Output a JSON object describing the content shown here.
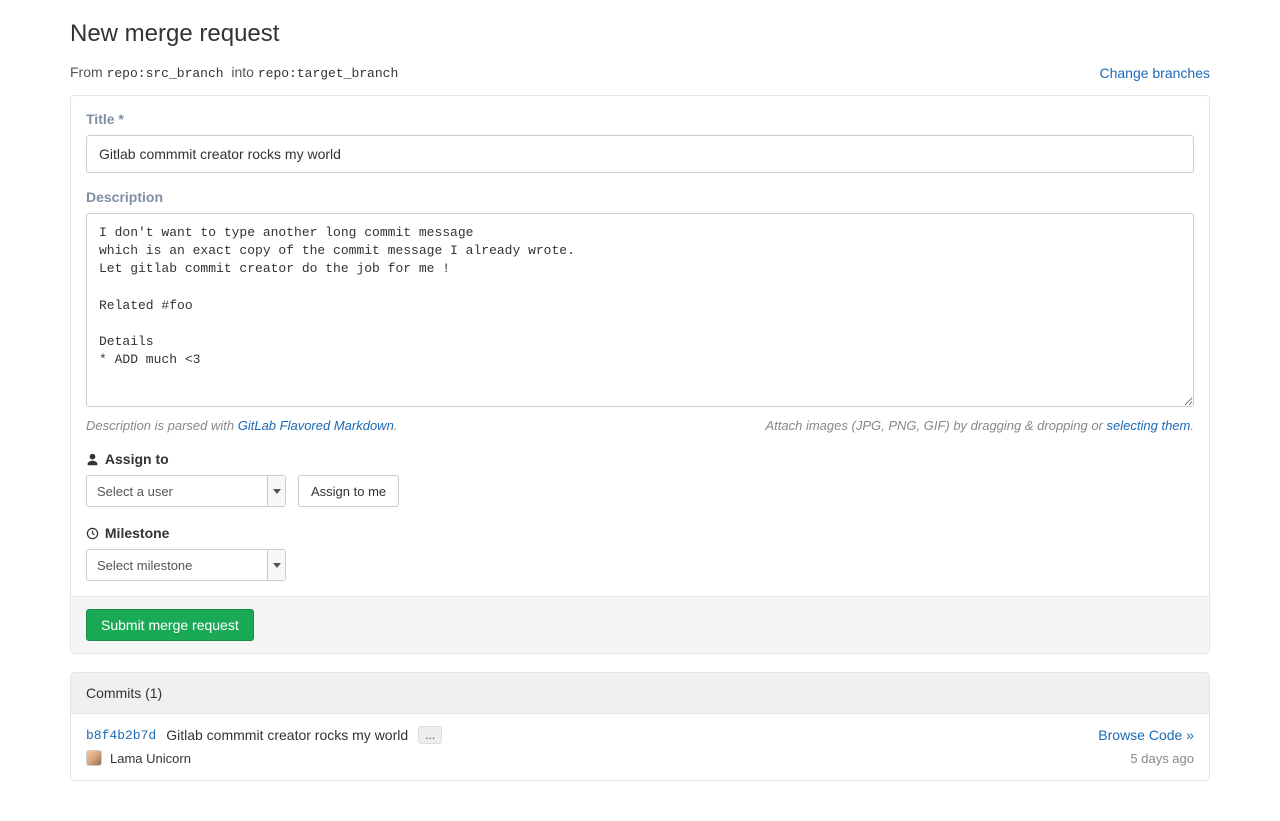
{
  "header": {
    "title": "New merge request",
    "from_label": "From",
    "into_label": "into",
    "source": "repo:src_branch",
    "target": "repo:target_branch",
    "change_branches": "Change branches"
  },
  "form": {
    "title_label": "Title *",
    "title_value": "Gitlab commmit creator rocks my world",
    "description_label": "Description",
    "description_value": "I don't want to type another long commit message\nwhich is an exact copy of the commit message I already wrote.\nLet gitlab commit creator do the job for me !\n\nRelated #foo\n\nDetails\n* ADD much <3",
    "hint_left_prefix": "Description is parsed with ",
    "hint_left_link": "GitLab Flavored Markdown",
    "hint_left_suffix": ".",
    "hint_right_prefix": "Attach images (JPG, PNG, GIF) by dragging & dropping or ",
    "hint_right_link": "selecting them",
    "hint_right_suffix": ".",
    "assign_label": "Assign to",
    "assign_placeholder": "Select a user",
    "assign_to_me": "Assign to me",
    "milestone_label": "Milestone",
    "milestone_placeholder": "Select milestone",
    "submit": "Submit merge request"
  },
  "commits": {
    "header": "Commits (1)",
    "items": [
      {
        "hash": "b8f4b2b7d",
        "message": "Gitlab commmit creator rocks my world",
        "ellipsis": "...",
        "browse": "Browse Code »",
        "author": "Lama Unicorn",
        "time": "5 days ago"
      }
    ]
  }
}
